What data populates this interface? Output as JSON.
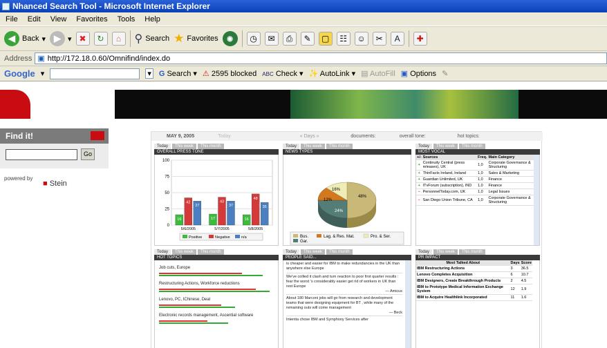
{
  "window": {
    "title": "Nhanced Search Tool - Microsoft Internet Explorer"
  },
  "menu": [
    "File",
    "Edit",
    "View",
    "Favorites",
    "Tools",
    "Help"
  ],
  "toolbar": {
    "back": "Back",
    "search": "Search",
    "favorites": "Favorites"
  },
  "address": {
    "label": "Address",
    "url": "http://172.18.0.60/Omnifind/index.do"
  },
  "google": {
    "logo": "Google",
    "search": "Search",
    "blocked": "2595 blocked",
    "check": "Check",
    "autolink": "AutoLink",
    "autofill": "AutoFill",
    "options": "Options"
  },
  "side": {
    "findit": "Find it!",
    "go": "Go",
    "powered": "powered by",
    "stein": "Stein"
  },
  "dash": {
    "date": "MAY 9, 2005",
    "today": "Today",
    "days": "« Days »",
    "documents": "documents:",
    "overall_tone": "overall tone:",
    "hot_topics": "hot topics:",
    "tab_today": "Today",
    "tab_week": "This week",
    "tab_month": "This month",
    "p1": "OVERALL PRESS TONE",
    "p2": "NEWS TYPES",
    "p3": "MOST VOCAL",
    "p4": "HOT TOPICS",
    "p5": "PEOPLE SAID...",
    "p6": "PR IMPACT",
    "legend1": [
      "Positive",
      "Negative",
      "n/a"
    ],
    "legend2": [
      "Bus.",
      "Lag. & Res. Mat.",
      "Pro. & Ser.",
      "Gar."
    ],
    "pie_labels": [
      "16%",
      "12%",
      "48%",
      "24%"
    ],
    "yaxis": [
      "100",
      "75",
      "50",
      "25",
      "0"
    ],
    "xaxis": [
      "5/6/2005",
      "5/7/2005",
      "5/8/2005"
    ],
    "vocal_head": [
      "+/-",
      "Sources",
      "Freq.",
      "Main Category"
    ],
    "vocal": [
      [
        "+",
        "Continuity Central (press releases), UK",
        "1,0",
        "Corporate Governance & Structuring"
      ],
      [
        "+",
        "ThinFacts Ireland, Ireland",
        "1,0",
        "Sales & Marketing"
      ],
      [
        "+",
        "Guardian Unlimited, UK",
        "1,0",
        "Finance"
      ],
      [
        "+",
        "ITvForum (subscription), IND",
        "1,0",
        "Finance"
      ],
      [
        "−",
        "PersonnelToday.com, UK",
        "1,0",
        "Legal Issues"
      ],
      [
        "−",
        "San Diego Union Tribune, CA",
        "1,0",
        "Corporate Governance & Structuring"
      ]
    ],
    "hot": [
      "Job cuts, Europe",
      "Restructuring Actions, Workforce reductions",
      "Lenovo, PC, IChinese, Deal",
      "Electronic records management, Ascential software"
    ],
    "said": [
      "is cheaper and easier for IBM to make redundancies in the UK than anywhere else Europe",
      "We've collied it clash and turn reaction to poor first quarter results : fear the worst 's considerably easier get rid of workers in UK than rest Europe",
      "— Amicus",
      "About 180 Marconi jobs will go from research and development teams that were designing equipment for BT , while many of the remaining outs will come management",
      "— Beck",
      "Intentia chose IBM and Symphony Services after"
    ],
    "impact_head": [
      "Most Talked About",
      "Days",
      "Score"
    ],
    "impact": [
      [
        "IBM Restructuring Actions",
        "3",
        "36.5"
      ],
      [
        "Lenovo Completes Acquisition",
        "6",
        "10.7"
      ],
      [
        "IBM Designers, Create Breakthrough Products",
        "2",
        "4.5"
      ],
      [
        "IBM to Prototype Medical Information Exchange System",
        "12",
        "1.9"
      ],
      [
        "IBM to Acquire Healthlink Incorporated",
        "11",
        "1.6"
      ]
    ]
  },
  "chart_data": [
    {
      "type": "bar",
      "categories": [
        "5/6/2005",
        "5/7/2005",
        "5/8/2005"
      ],
      "series": [
        {
          "name": "Positive",
          "values": [
            16,
            17,
            16
          ]
        },
        {
          "name": "Negative",
          "values": [
            42,
            43,
            48
          ]
        },
        {
          "name": "n/a",
          "values": [
            37,
            37,
            35
          ]
        }
      ],
      "ylim": [
        0,
        100
      ],
      "data_labels": [
        "16",
        "42",
        "37",
        "17",
        "43",
        "37",
        "16",
        "48",
        "35"
      ]
    },
    {
      "type": "pie",
      "categories": [
        "Bus.",
        "Lag. & Res. Mat.",
        "Pro. & Ser.",
        "Gar."
      ],
      "values": [
        48,
        12,
        16,
        24
      ]
    }
  ]
}
